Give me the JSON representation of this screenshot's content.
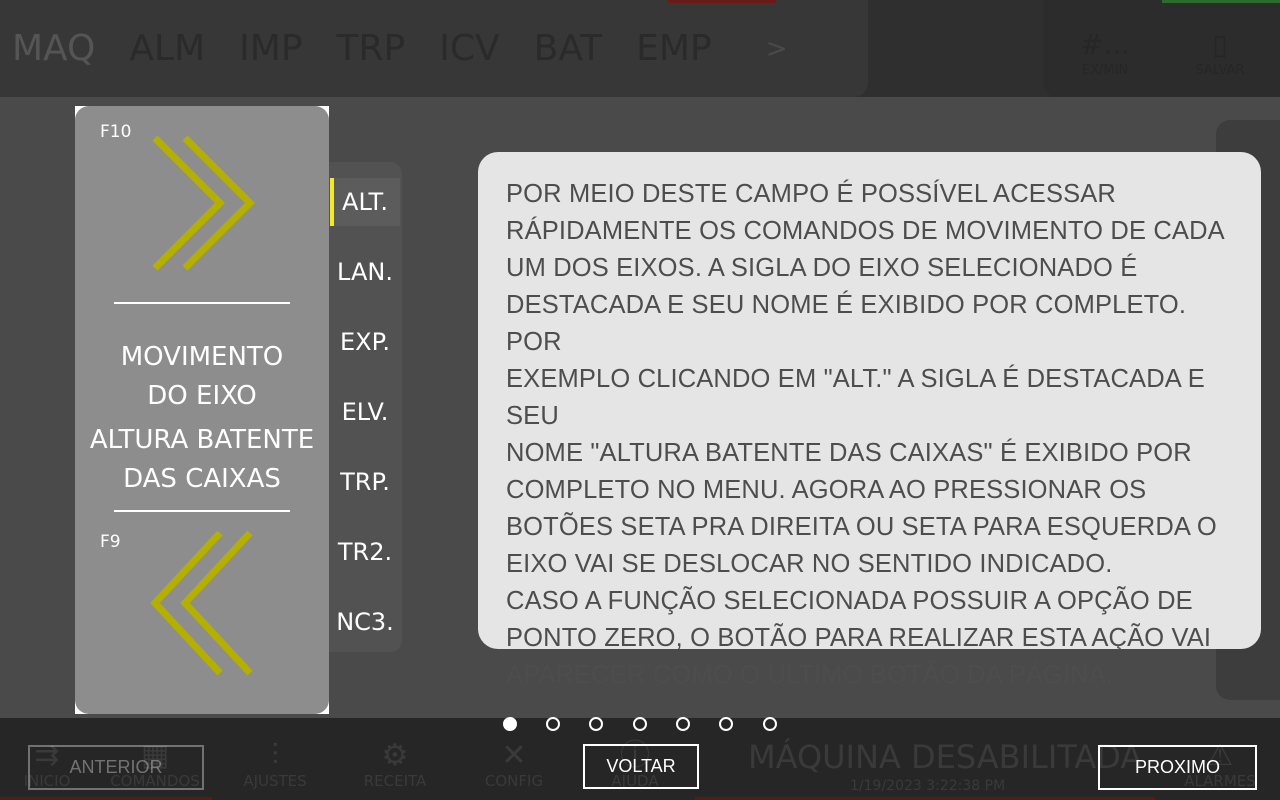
{
  "background": {
    "tabs": [
      "MAQ",
      "ALM",
      "IMP",
      "TRP",
      "ICV",
      "BAT",
      "EMP"
    ],
    "more": ">",
    "counter_value": "#...",
    "counter_label": "EX/MIN",
    "save_label": "SALVAR",
    "nav": [
      "INICIO",
      "COMANDOS",
      "AJUSTES",
      "RECEITA",
      "CONFIG",
      "AJUDA",
      "ALARMES"
    ],
    "status": "MÁQUINA DESABILITADA",
    "datetime": "1/19/2023 3:22:38 PM"
  },
  "command_panel": {
    "f10_label": "F10",
    "f9_label": "F9",
    "title_line1": "MOVIMENTO",
    "title_line2": "DO EIXO",
    "axis_line1": "ALTURA BATENTE",
    "axis_line2": "DAS CAIXAS",
    "arrow_color": "#b5b000"
  },
  "axes": [
    "ALT.",
    "LAN.",
    "EXP.",
    "ELV.",
    "TRP.",
    "TR2.",
    "NC3."
  ],
  "tooltip": {
    "lines": [
      "POR MEIO DESTE CAMPO É POSSÍVEL ACESSAR",
      "RÁPIDAMENTE OS COMANDOS DE MOVIMENTO DE CADA",
      "UM DOS EIXOS. A SIGLA DO EIXO SELECIONADO É",
      "DESTACADA E SEU NOME É EXIBIDO POR COMPLETO. POR",
      "EXEMPLO CLICANDO EM \"ALT.\" A SIGLA É DESTACADA E SEU",
      "NOME \"ALTURA BATENTE DAS CAIXAS\" É EXIBIDO POR",
      "COMPLETO NO MENU. AGORA AO PRESSIONAR OS",
      "BOTÕES SETA PRA DIREITA OU SETA PARA ESQUERDA O",
      "EIXO VAI SE DESLOCAR NO SENTIDO INDICADO.",
      "CASO A FUNÇÃO SELECIONADA POSSUIR A OPÇÃO DE",
      "PONTO ZERO, O BOTÃO PARA REALIZAR ESTA AÇÃO VAI",
      "APARECER COMO O ULTIMO BOTÃO DA PÁGINA."
    ]
  },
  "tutorial": {
    "page_count": 7,
    "current_page": 1,
    "prev_label": "ANTERIOR",
    "back_label": "VOLTAR",
    "next_label": "PROXIMO"
  },
  "colors": {
    "highlight": "#f0ea2a",
    "tooltip_bg": "#e5e5e5",
    "tooltip_text": "#4d4d4d"
  }
}
